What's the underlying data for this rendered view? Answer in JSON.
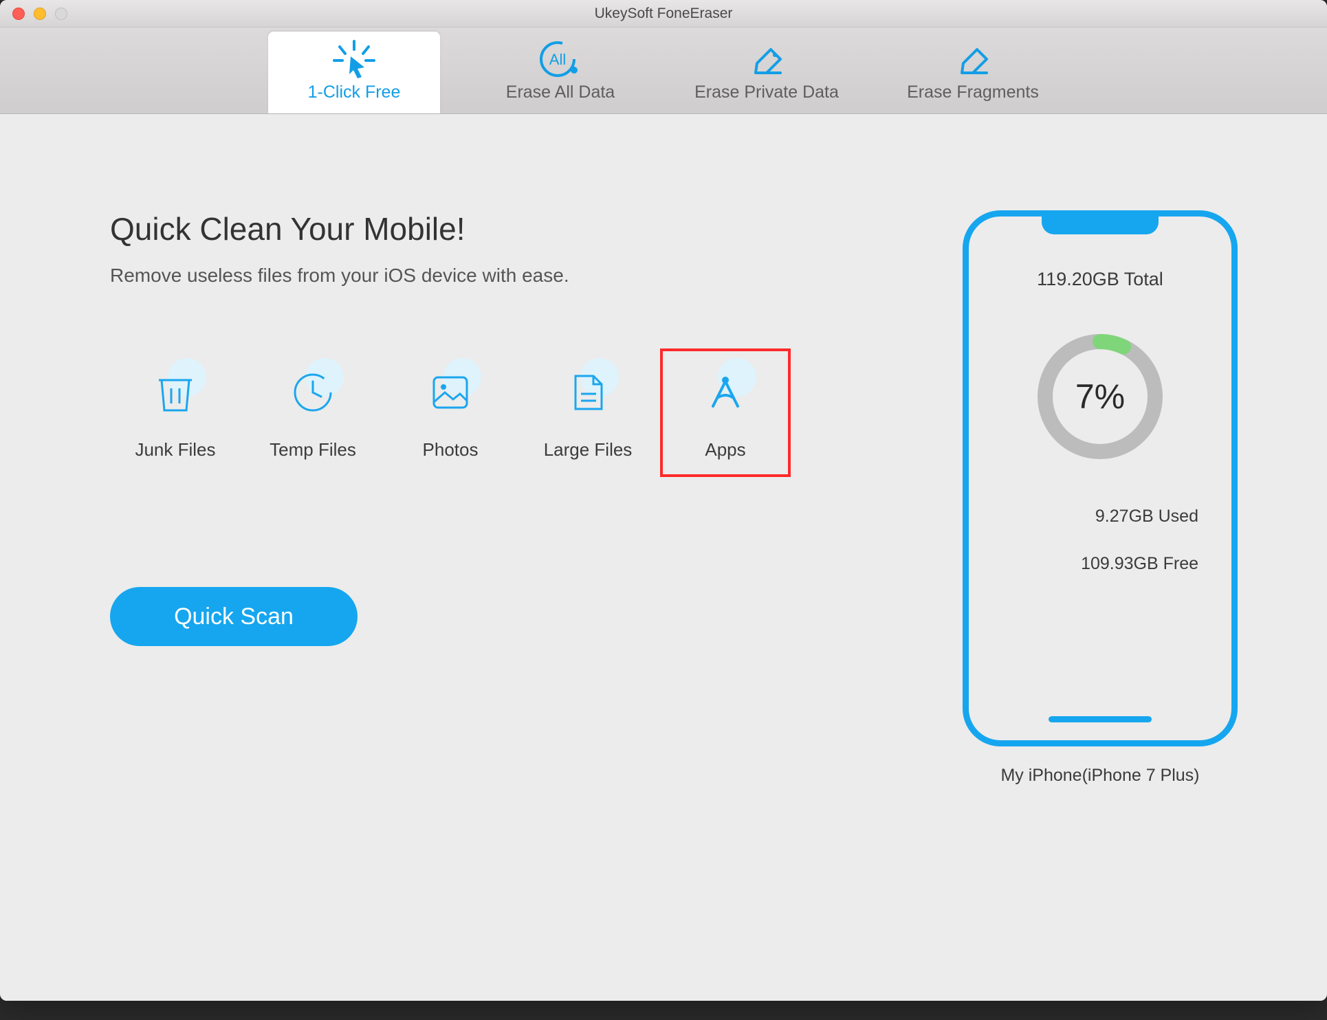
{
  "window": {
    "title": "UkeySoft FoneEraser"
  },
  "tabs": [
    {
      "label": "1-Click Free"
    },
    {
      "label": "Erase All Data"
    },
    {
      "label": "Erase Private Data"
    },
    {
      "label": "Erase Fragments"
    }
  ],
  "main": {
    "heading": "Quick Clean Your Mobile!",
    "sub": "Remove useless files from your iOS device with ease.",
    "categories": [
      {
        "label": "Junk Files"
      },
      {
        "label": "Temp Files"
      },
      {
        "label": "Photos"
      },
      {
        "label": "Large Files"
      },
      {
        "label": "Apps"
      }
    ],
    "scan_button": "Quick Scan"
  },
  "phone": {
    "total": "119.20GB Total",
    "percent_text": "7%",
    "percent_value": 7,
    "used": "9.27GB Used",
    "free": "109.93GB Free",
    "device": "My iPhone(iPhone 7 Plus)"
  },
  "colors": {
    "accent": "#16a6ef",
    "ring_green": "#7fd67a",
    "ring_grey": "#bcbcbc"
  }
}
